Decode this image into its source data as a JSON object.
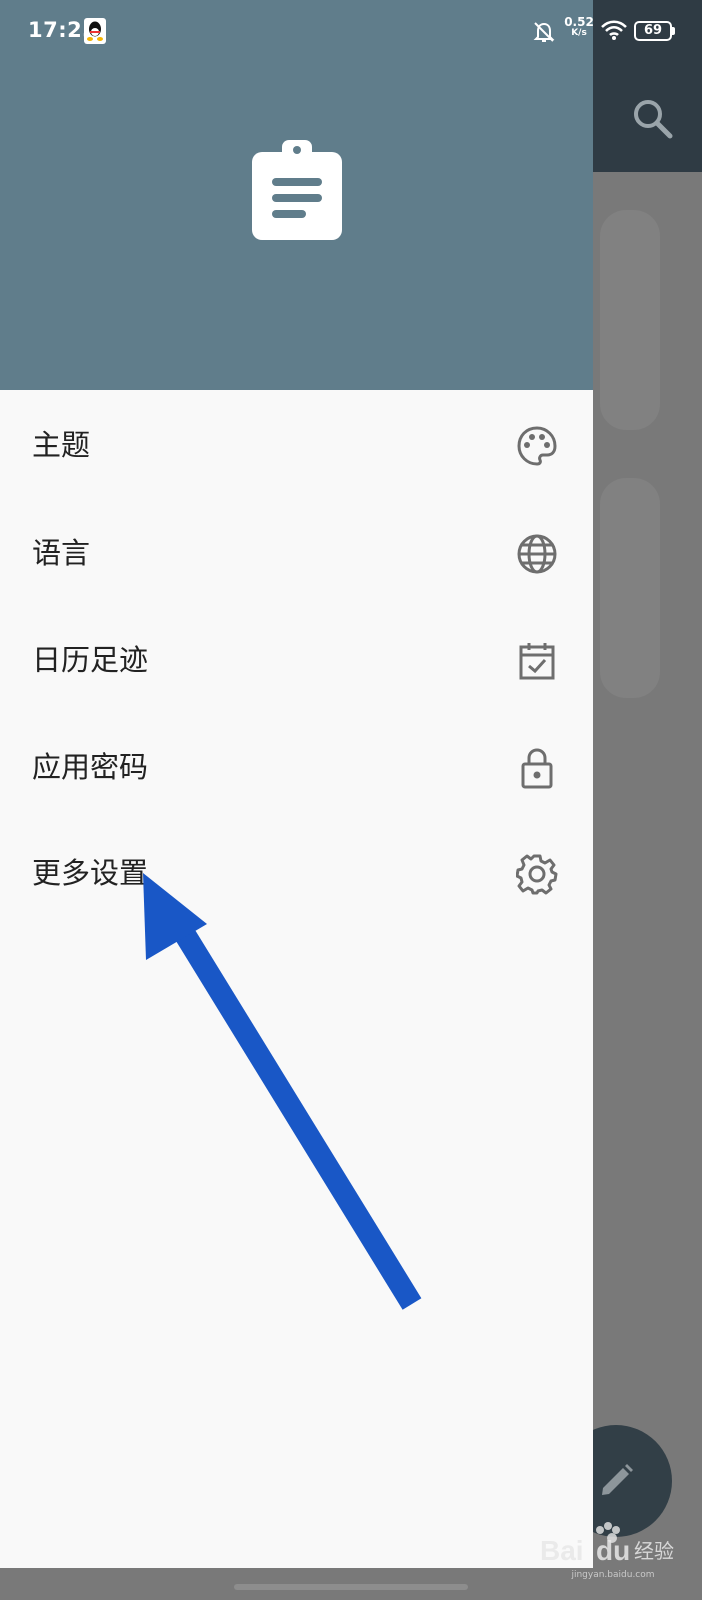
{
  "status_bar": {
    "time": "17:25",
    "net_speed_value": "0.52",
    "net_speed_unit": "K/s",
    "battery_level": "69"
  },
  "drawer": {
    "header_icon": "clipboard-list-icon",
    "items": [
      {
        "label": "主题",
        "icon": "palette-icon"
      },
      {
        "label": "语言",
        "icon": "globe-icon"
      },
      {
        "label": "日历足迹",
        "icon": "calendar-check-icon"
      },
      {
        "label": "应用密码",
        "icon": "lock-icon"
      },
      {
        "label": "更多设置",
        "icon": "gear-icon"
      }
    ]
  },
  "background_app": {
    "toolbar_icon": "search-icon",
    "fab_icon": "pencil-icon"
  },
  "annotation": {
    "arrow_color": "#1957c6",
    "points_to": "更多设置"
  },
  "watermark": {
    "brand": "Baidu 经验",
    "sub": "jingyan.baidu.com"
  },
  "colors": {
    "drawer_header": "#607d8b",
    "drawer_bg": "#f9f9f9",
    "toolbar": "#2f3b44",
    "scrim": "#797979"
  }
}
